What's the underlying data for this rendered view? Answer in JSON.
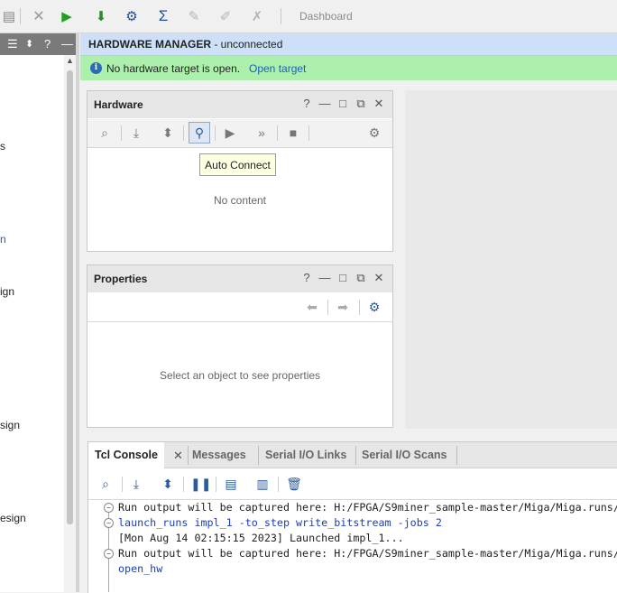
{
  "toolbar": {
    "items": [
      "copy-icon",
      "close-icon",
      "run-icon",
      "program-device-icon",
      "settings-icon",
      "sigma-icon",
      "run-tool-icon",
      "edit-tool-icon",
      "tools-icon"
    ],
    "dashboard_label": "Dashboard"
  },
  "left_panel": {
    "header_icons": [
      "collapse-all-icon",
      "expand-icon",
      "help-icon",
      "minimize-icon"
    ],
    "items": [
      "s",
      "n",
      "ign",
      "sign",
      "esign"
    ]
  },
  "hardware_manager": {
    "title": "HARDWARE MANAGER",
    "status": " - unconnected",
    "info_icon": "i",
    "notice": "No hardware target is open.",
    "open_target_link": "Open target"
  },
  "hardware_panel": {
    "title": "Hardware",
    "empty_text": "No content",
    "tooltip": "Auto Connect"
  },
  "properties_panel": {
    "title": "Properties",
    "empty_text": "Select an object to see properties"
  },
  "panel_header_glyphs": {
    "help": "?",
    "minimize": "—",
    "maximize": "□",
    "float": "⧉",
    "close": "✕"
  },
  "tcl_console": {
    "tabs": [
      "Tcl Console",
      "Messages",
      "Serial I/O Links",
      "Serial I/O Scans"
    ],
    "close_glyph": "✕",
    "lines": [
      "Run output will be captured here: H:/FPGA/S9miner_sample-master/Miga/Miga.runs/",
      "launch_runs impl_1 -to_step write_bitstream -jobs 2",
      "[Mon Aug 14 02:15:15 2023] Launched impl_1...",
      "Run output will be captured here: H:/FPGA/S9miner_sample-master/Miga/Miga.runs/",
      "open_hw"
    ]
  },
  "colors": {
    "header_blue": "#cde0f7",
    "notice_green": "#adf0ad",
    "link_blue": "#1a5fb4",
    "command_blue": "#1a3fbf"
  }
}
